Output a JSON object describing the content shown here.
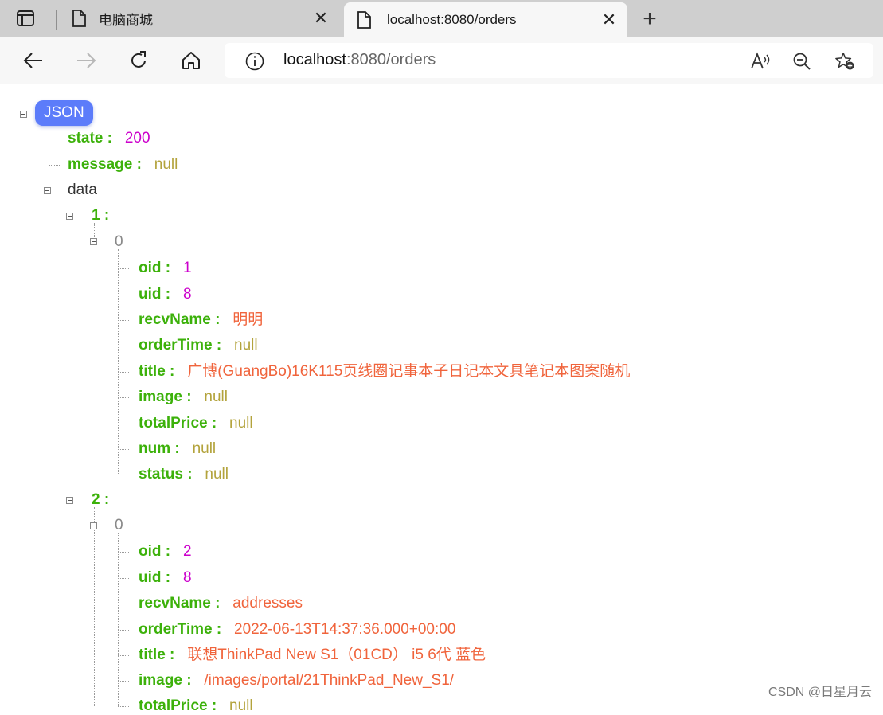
{
  "tabs": [
    {
      "title": "电脑商城",
      "active": false
    },
    {
      "title": "localhost:8080/orders",
      "active": true
    }
  ],
  "address_bar": {
    "host": "localhost",
    "rest": ":8080/orders"
  },
  "json_badge": "JSON",
  "root": {
    "state": {
      "key": "state :",
      "value": "200"
    },
    "message": {
      "key": "message :",
      "value": "null"
    },
    "data_key": "data",
    "groups": [
      {
        "key": "1 :",
        "index": "0",
        "fields": [
          {
            "key": "oid :",
            "value": "1",
            "type": "num"
          },
          {
            "key": "uid :",
            "value": "8",
            "type": "num"
          },
          {
            "key": "recvName :",
            "value": "明明",
            "type": "str"
          },
          {
            "key": "orderTime :",
            "value": "null",
            "type": "nul"
          },
          {
            "key": "title :",
            "value": "广博(GuangBo)16K115页线圈记事本子日记本文具笔记本图案随机",
            "type": "str"
          },
          {
            "key": "image :",
            "value": "null",
            "type": "nul"
          },
          {
            "key": "totalPrice :",
            "value": "null",
            "type": "nul"
          },
          {
            "key": "num :",
            "value": "null",
            "type": "nul"
          },
          {
            "key": "status :",
            "value": "null",
            "type": "nul"
          }
        ]
      },
      {
        "key": "2 :",
        "index": "0",
        "fields": [
          {
            "key": "oid :",
            "value": "2",
            "type": "num"
          },
          {
            "key": "uid :",
            "value": "8",
            "type": "num"
          },
          {
            "key": "recvName :",
            "value": "addresses",
            "type": "str"
          },
          {
            "key": "orderTime :",
            "value": "2022-06-13T14:37:36.000+00:00",
            "type": "str"
          },
          {
            "key": "title :",
            "value": "联想ThinkPad New S1（01CD） i5 6代 蓝色",
            "type": "str"
          },
          {
            "key": "image :",
            "value": "/images/portal/21ThinkPad_New_S1/",
            "type": "str"
          },
          {
            "key": "totalPrice :",
            "value": "null",
            "type": "nul"
          }
        ]
      }
    ]
  },
  "watermark": "CSDN @日星月云",
  "colors": {
    "key": "#3cb10a",
    "number": "#cc00cc",
    "null": "#b3a33c",
    "string": "#f0643c",
    "badge": "#5c7cfa"
  }
}
